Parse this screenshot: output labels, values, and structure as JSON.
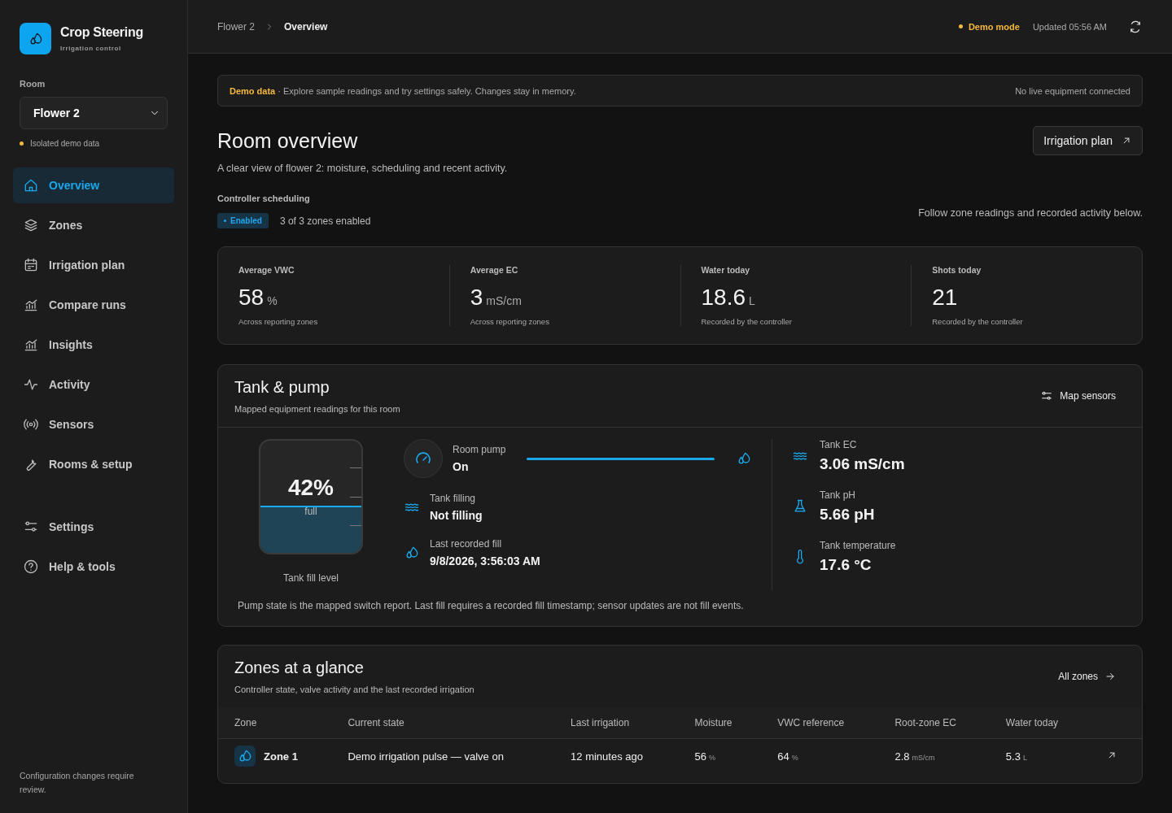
{
  "brand": {
    "title": "Crop Steering",
    "subtitle": "Irrigation control"
  },
  "room": {
    "label": "Room",
    "value": "Flower 2",
    "note": "Isolated demo data"
  },
  "nav": [
    {
      "label": "Overview",
      "selected": true
    },
    {
      "label": "Zones",
      "selected": false
    },
    {
      "label": "Irrigation plan",
      "selected": false
    },
    {
      "label": "Compare runs",
      "selected": false
    },
    {
      "label": "Insights",
      "selected": false
    },
    {
      "label": "Activity",
      "selected": false
    },
    {
      "label": "Sensors",
      "selected": false
    },
    {
      "label": "Rooms & setup",
      "selected": false
    }
  ],
  "nav_bottom": [
    {
      "label": "Settings",
      "selected": false
    },
    {
      "label": "Help & tools",
      "selected": false
    }
  ],
  "sidebar_footer": "Configuration changes require review.",
  "breadcrumb": [
    "Flower 2",
    "Overview"
  ],
  "topbar": {
    "mode": "Demo mode",
    "updated": "Updated 05:56 AM"
  },
  "banner": {
    "text": "**Demo data** · Explore sample readings and try settings safely. Changes stay in memory.",
    "right": "No live equipment connected"
  },
  "page": {
    "title": "Room overview",
    "subtitle": "A clear view of flower 2: moisture, scheduling and recent activity.",
    "button": "Irrigation plan"
  },
  "scheduling": {
    "label": "Controller scheduling",
    "badge": "Enabled",
    "count": "3 of 3 zones enabled",
    "hint": "Follow zone readings and recorded activity below."
  },
  "stats": [
    {
      "label": "Average VWC",
      "value": "58",
      "unit": "%",
      "note": "Across reporting zones"
    },
    {
      "label": "Average EC",
      "value": "3",
      "unit": "mS/cm",
      "note": "Across reporting zones"
    },
    {
      "label": "Water today",
      "value": "18.6",
      "unit": "L",
      "note": "Recorded by the controller"
    },
    {
      "label": "Shots today",
      "value": "21",
      "note": "Recorded by the controller"
    }
  ],
  "tank": {
    "title": "Tank & pump",
    "subtitle": "Mapped equipment readings for this room",
    "button": "Map sensors",
    "fill": {
      "percent": "42%",
      "word": "full",
      "level": 0.42,
      "caption": "Tank fill level"
    },
    "pump": {
      "label": "Room pump",
      "state": "On",
      "on": true
    },
    "filling": {
      "label": "Tank filling",
      "state": "Not filling"
    },
    "last_fill": {
      "label": "Last recorded fill",
      "value": "9/8/2026, 3:56:03 AM"
    },
    "readings": [
      {
        "label": "Tank EC",
        "value": "3.06 mS/cm"
      },
      {
        "label": "Tank pH",
        "value": "5.66 pH"
      },
      {
        "label": "Tank temperature",
        "value": "17.6 °C"
      }
    ],
    "footnote": "Pump state is the mapped switch report. Last fill requires a recorded fill timestamp; sensor updates are not fill events."
  },
  "zones": {
    "title": "Zones at a glance",
    "subtitle": "Controller state, valve activity and the last recorded irrigation",
    "button": "All zones",
    "columns": [
      "Zone",
      "Current state",
      "Last irrigation",
      "Moisture",
      "VWC reference",
      "Root-zone EC",
      "Water today"
    ],
    "rows": [
      {
        "zone": "Zone 1",
        "state": "Demo irrigation pulse — valve on",
        "last": "12 minutes ago",
        "moisture": "56",
        "moisture_unit": "%",
        "vwc": "64",
        "vwc_unit": "%",
        "ec": "2.8",
        "ec_unit": "mS/cm",
        "water": "5.3",
        "water_unit": "L"
      }
    ]
  }
}
